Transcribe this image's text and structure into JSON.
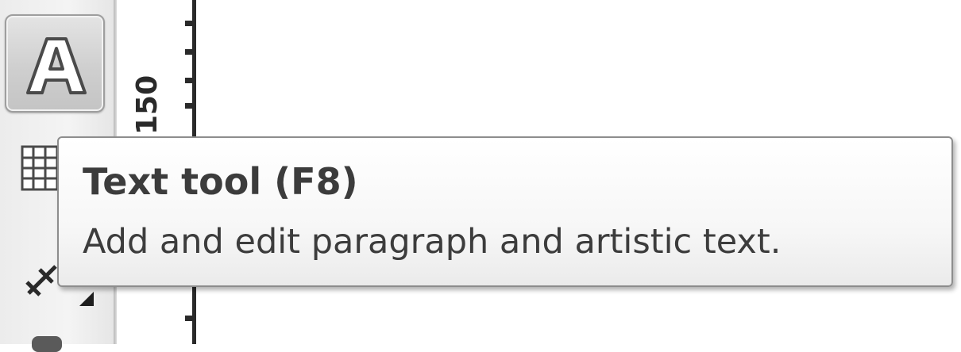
{
  "toolbox": {
    "tools": [
      {
        "name": "text-tool",
        "icon": "text-a-icon",
        "selected": true
      },
      {
        "name": "table-tool",
        "icon": "table-icon",
        "selected": false
      },
      {
        "name": "parallel-dimension-tool",
        "icon": "parallel-dimension-icon",
        "selected": false
      }
    ]
  },
  "ruler": {
    "label": "150"
  },
  "tooltip": {
    "title": "Text tool (F8)",
    "description": "Add and edit paragraph and artistic text."
  },
  "colors": {
    "toolbox_bg": "#ececec",
    "tooltip_border": "#8d8d8d",
    "text": "#3c3c3c"
  }
}
